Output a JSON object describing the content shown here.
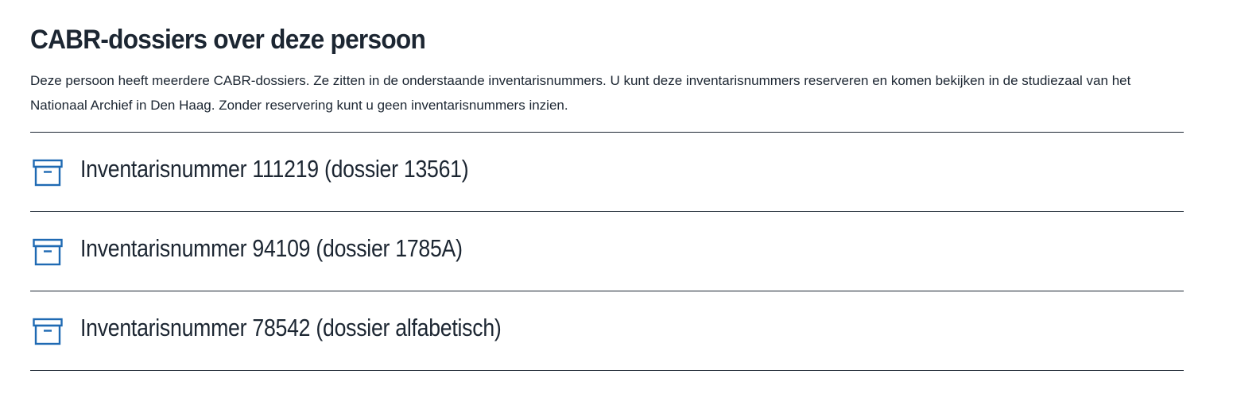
{
  "section": {
    "title": "CABR-dossiers over deze persoon",
    "intro": "Deze persoon heeft meerdere CABR-dossiers. Ze zitten in de onderstaande inventarisnummers. U kunt deze inventarisnummers reserveren en komen bekijken in de studiezaal van het Nationaal Archief in Den Haag. Zonder reservering kunt u geen inventarisnummers inzien."
  },
  "dossiers": [
    {
      "label": "Inventarisnummer 111219 (dossier 13561)",
      "icon": "archive-box-icon"
    },
    {
      "label": "Inventarisnummer 94109 (dossier 1785A)",
      "icon": "archive-box-icon"
    },
    {
      "label": "Inventarisnummer 78542 (dossier alfabetisch)",
      "icon": "archive-box-icon"
    }
  ],
  "colors": {
    "text": "#1c2632",
    "icon_accent": "#1f6ab3",
    "divider": "#1c2632",
    "background": "#ffffff"
  }
}
